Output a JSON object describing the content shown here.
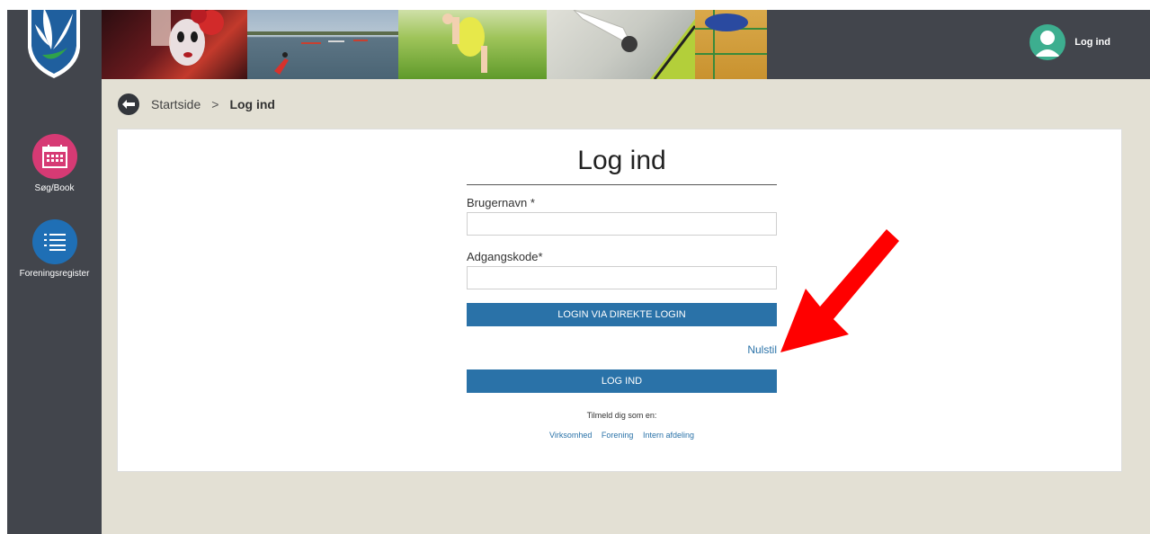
{
  "sidebar": {
    "items": [
      {
        "label": "Søg/Book",
        "icon": "calendar-icon",
        "color": "#d63a74"
      },
      {
        "label": "Foreningsregister",
        "icon": "list-icon",
        "color": "#1f6fb5"
      }
    ]
  },
  "header": {
    "user_label": "Log ind",
    "avatar_color": "#3dae8f"
  },
  "breadcrumb": {
    "home": "Startside",
    "separator": ">",
    "current": "Log ind"
  },
  "login": {
    "title": "Log ind",
    "username_label": "Brugernavn *",
    "username_value": "",
    "password_label": "Adgangskode*",
    "password_value": "",
    "direct_login_label": "LOGIN VIA DIREKTE LOGIN",
    "reset_label": "Nulstil",
    "login_label": "LOG IND",
    "signup_title": "Tilmeld dig som en:",
    "signup_links": [
      "Virksomhed",
      "Forening",
      "Intern afdeling"
    ]
  },
  "colors": {
    "sidebar_bg": "#42454c",
    "page_bg": "#e3e0d4",
    "button_blue": "#2a72a8",
    "annotation_arrow": "#ff0000"
  }
}
